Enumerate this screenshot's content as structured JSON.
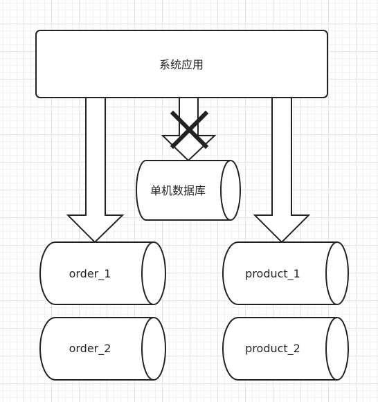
{
  "diagram": {
    "app_box": {
      "label": "系统应用"
    },
    "standalone_db": {
      "label": "单机数据库",
      "connection_blocked": true
    },
    "databases": {
      "order_1": {
        "label": "order_1"
      },
      "order_2": {
        "label": "order_2"
      },
      "product_1": {
        "label": "product_1"
      },
      "product_2": {
        "label": "product_2"
      }
    }
  }
}
